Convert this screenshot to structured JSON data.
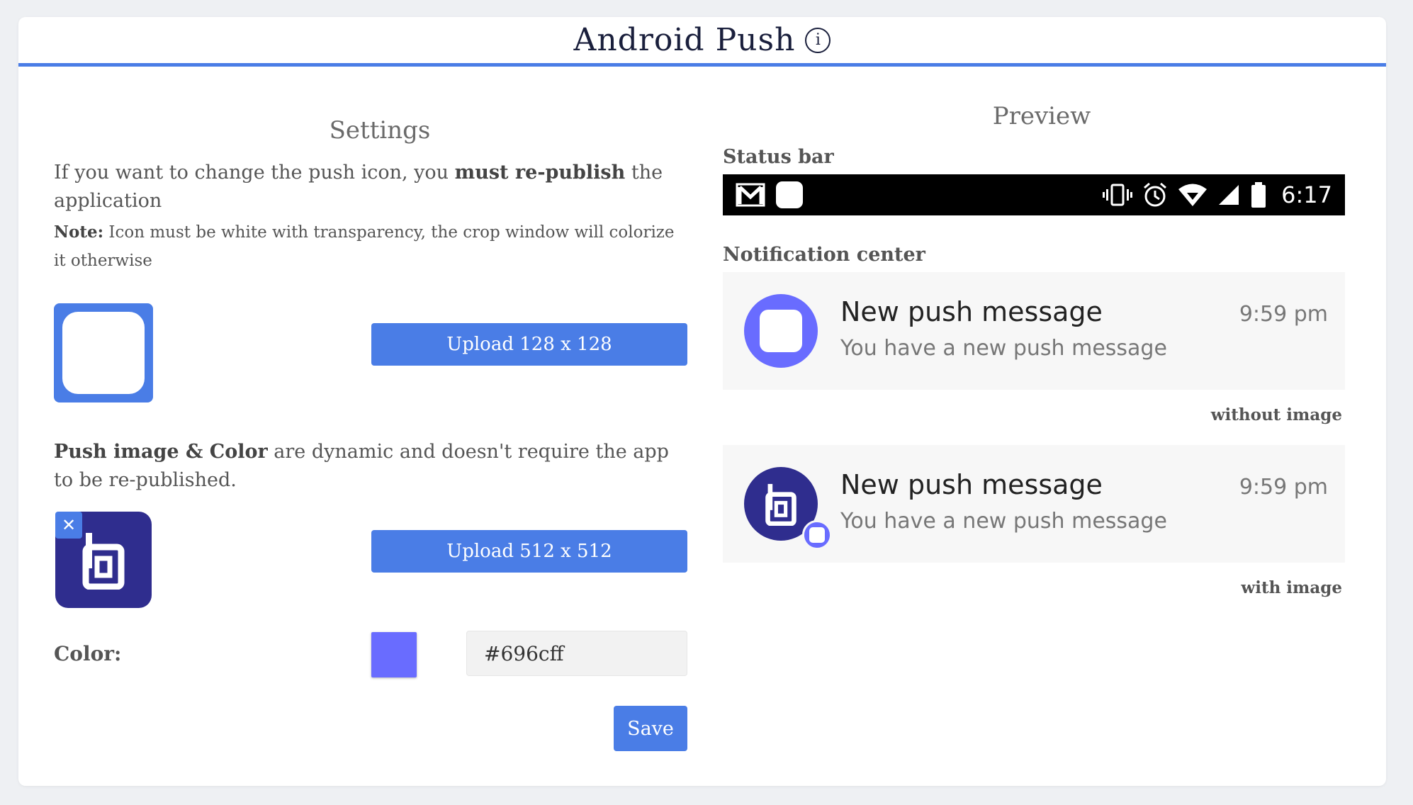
{
  "header": {
    "title": "Android Push",
    "info_icon": "info-icon"
  },
  "settings": {
    "title": "Settings",
    "desc_pre": "If you want to change the push icon, you ",
    "desc_bold": "must re-publish",
    "desc_post": " the application",
    "note_bold": "Note:",
    "note_text": " Icon must be white with transparency, the crop window will colorize it otherwise",
    "upload_small_label": "Upload 128 x 128",
    "dynamic_bold": "Push image & Color",
    "dynamic_text": " are dynamic and doesn't require the app to be re-published.",
    "upload_large_label": "Upload 512 x 512",
    "remove_icon": "close-icon",
    "color_label": "Color:",
    "color_value": "#696cff",
    "save_label": "Save"
  },
  "preview": {
    "title": "Preview",
    "status_bar_label": "Status bar",
    "status_time": "6:17",
    "notification_center_label": "Notification center",
    "notifications": [
      {
        "title": "New push message",
        "body": "You have a new push message",
        "time": "9:59 pm",
        "caption": "without image"
      },
      {
        "title": "New push message",
        "body": "You have a new push message",
        "time": "9:59 pm",
        "caption": "with image"
      }
    ]
  },
  "colors": {
    "accent": "#4a7de6",
    "push_color": "#696cff",
    "image_bg": "#2f2d8e"
  }
}
